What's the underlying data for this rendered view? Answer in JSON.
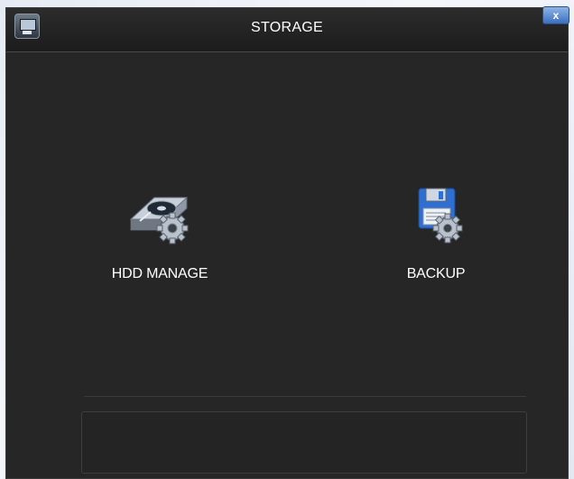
{
  "window": {
    "title": "STORAGE",
    "close_label": "x",
    "app_icon": "monitor-icon"
  },
  "menu": {
    "items": [
      {
        "label": "HDD MANAGE",
        "icon": "hdd-gear-icon"
      },
      {
        "label": "BACKUP",
        "icon": "floppy-gear-icon"
      }
    ]
  },
  "colors": {
    "background": "#262626",
    "title_text": "#ffffff",
    "close_button": "#4f82cc"
  }
}
